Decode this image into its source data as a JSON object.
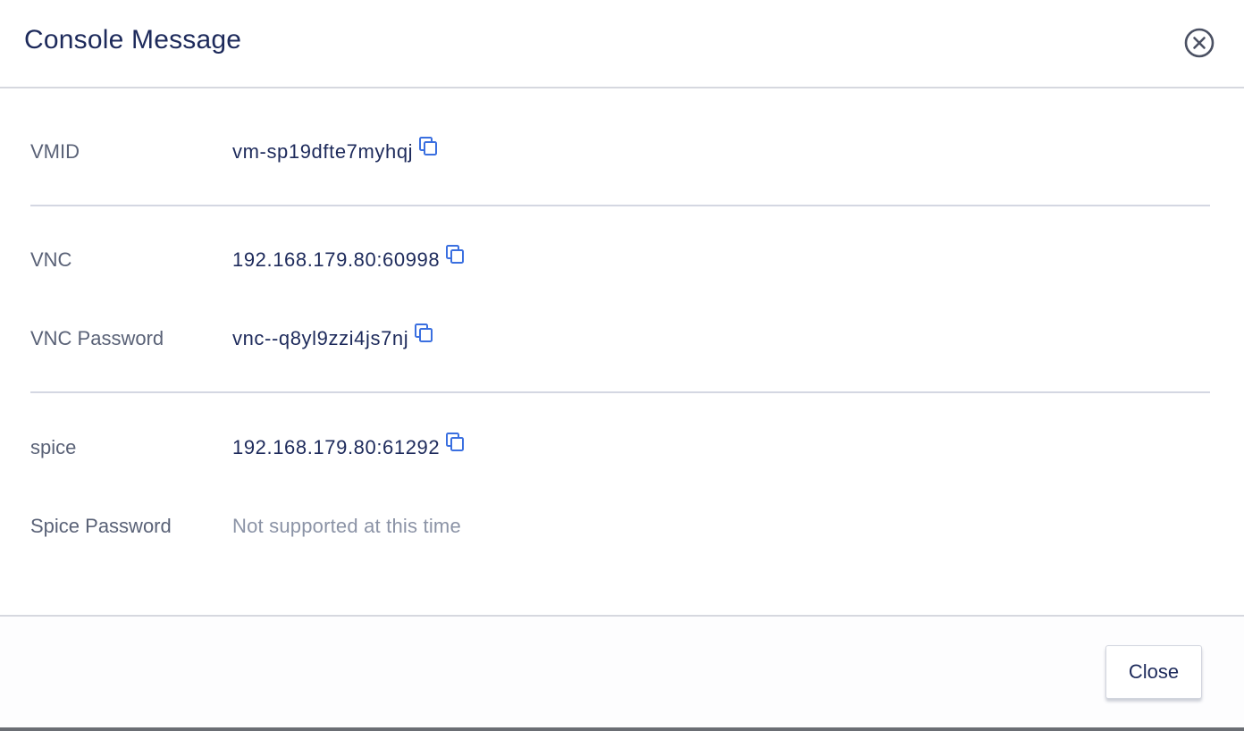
{
  "dialog": {
    "title": "Console Message",
    "close_label": "Close"
  },
  "rows": [
    {
      "label": "VMID",
      "value": "vm-sp19dfte7myhqj",
      "copyable": true
    },
    {
      "label": "VNC",
      "value": "192.168.179.80:60998",
      "copyable": true
    },
    {
      "label": "VNC Password",
      "value": "vnc--q8yl9zzi4js7nj",
      "copyable": true
    },
    {
      "label": "spice",
      "value": "192.168.179.80:61292",
      "copyable": true
    },
    {
      "label": "Spice Password",
      "value": "Not supported at this time",
      "copyable": false
    }
  ],
  "icons": {
    "dialog_close": "close-circle-icon",
    "copy": "copy-icon"
  },
  "colors": {
    "title": "#1d2a5b",
    "label": "#5a6277",
    "value": "#1d2a5b",
    "muted": "#8b93a6",
    "accent": "#3a6fe0",
    "divider": "#d4d7e2"
  }
}
